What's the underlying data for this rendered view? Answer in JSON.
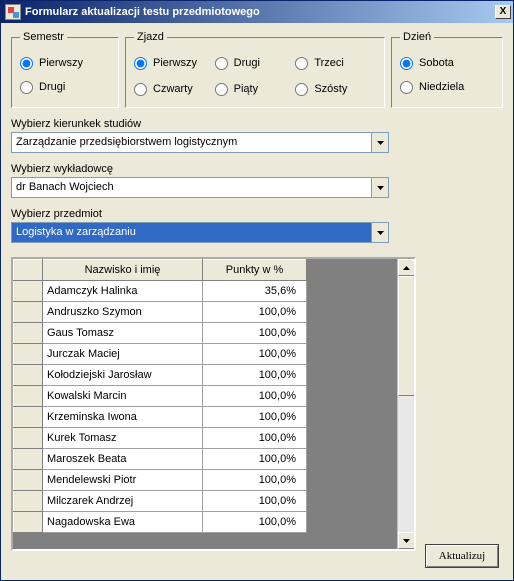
{
  "window": {
    "title": "Formularz aktualizacji testu przedmiotowego",
    "close": "X"
  },
  "groups": {
    "semestr": {
      "legend": "Semestr",
      "options": [
        "Pierwszy",
        "Drugi"
      ],
      "selected": "Pierwszy"
    },
    "zjazd": {
      "legend": "Zjazd",
      "options": [
        "Pierwszy",
        "Drugi",
        "Trzeci",
        "Czwarty",
        "Piąty",
        "Szósty"
      ],
      "selected": "Pierwszy"
    },
    "dzien": {
      "legend": "Dzień",
      "options": [
        "Sobota",
        "Niedziela"
      ],
      "selected": "Sobota"
    }
  },
  "selects": {
    "kierunek": {
      "label": "Wybierz kierunkek studiów",
      "value": "Zarządzanie przedsiębiorstwem logistycznym"
    },
    "wykladowca": {
      "label": "Wybierz wykładowcę",
      "value": "dr Banach Wojciech"
    },
    "przedmiot": {
      "label": "Wybierz przedmiot",
      "value": "Logistyka w zarządzaniu"
    }
  },
  "table": {
    "headers": [
      "Nazwisko i imię",
      "Punkty w %"
    ],
    "rows": [
      {
        "name": "Adamczyk Halinka",
        "value": "35,6%"
      },
      {
        "name": "Andruszko Szymon",
        "value": "100,0%"
      },
      {
        "name": "Gaus Tomasz",
        "value": "100,0%"
      },
      {
        "name": "Jurczak Maciej",
        "value": "100,0%"
      },
      {
        "name": "Kołodziejski Jarosław",
        "value": "100,0%"
      },
      {
        "name": "Kowalski Marcin",
        "value": "100,0%"
      },
      {
        "name": "Krzeminska Iwona",
        "value": "100,0%"
      },
      {
        "name": "Kurek Tomasz",
        "value": "100,0%"
      },
      {
        "name": "Maroszek Beata",
        "value": "100,0%"
      },
      {
        "name": "Mendelewski Piotr",
        "value": "100,0%"
      },
      {
        "name": "Milczarek Andrzej",
        "value": "100,0%"
      },
      {
        "name": "Nagadowska Ewa",
        "value": "100,0%"
      }
    ]
  },
  "buttons": {
    "update": "Aktualizuj"
  }
}
